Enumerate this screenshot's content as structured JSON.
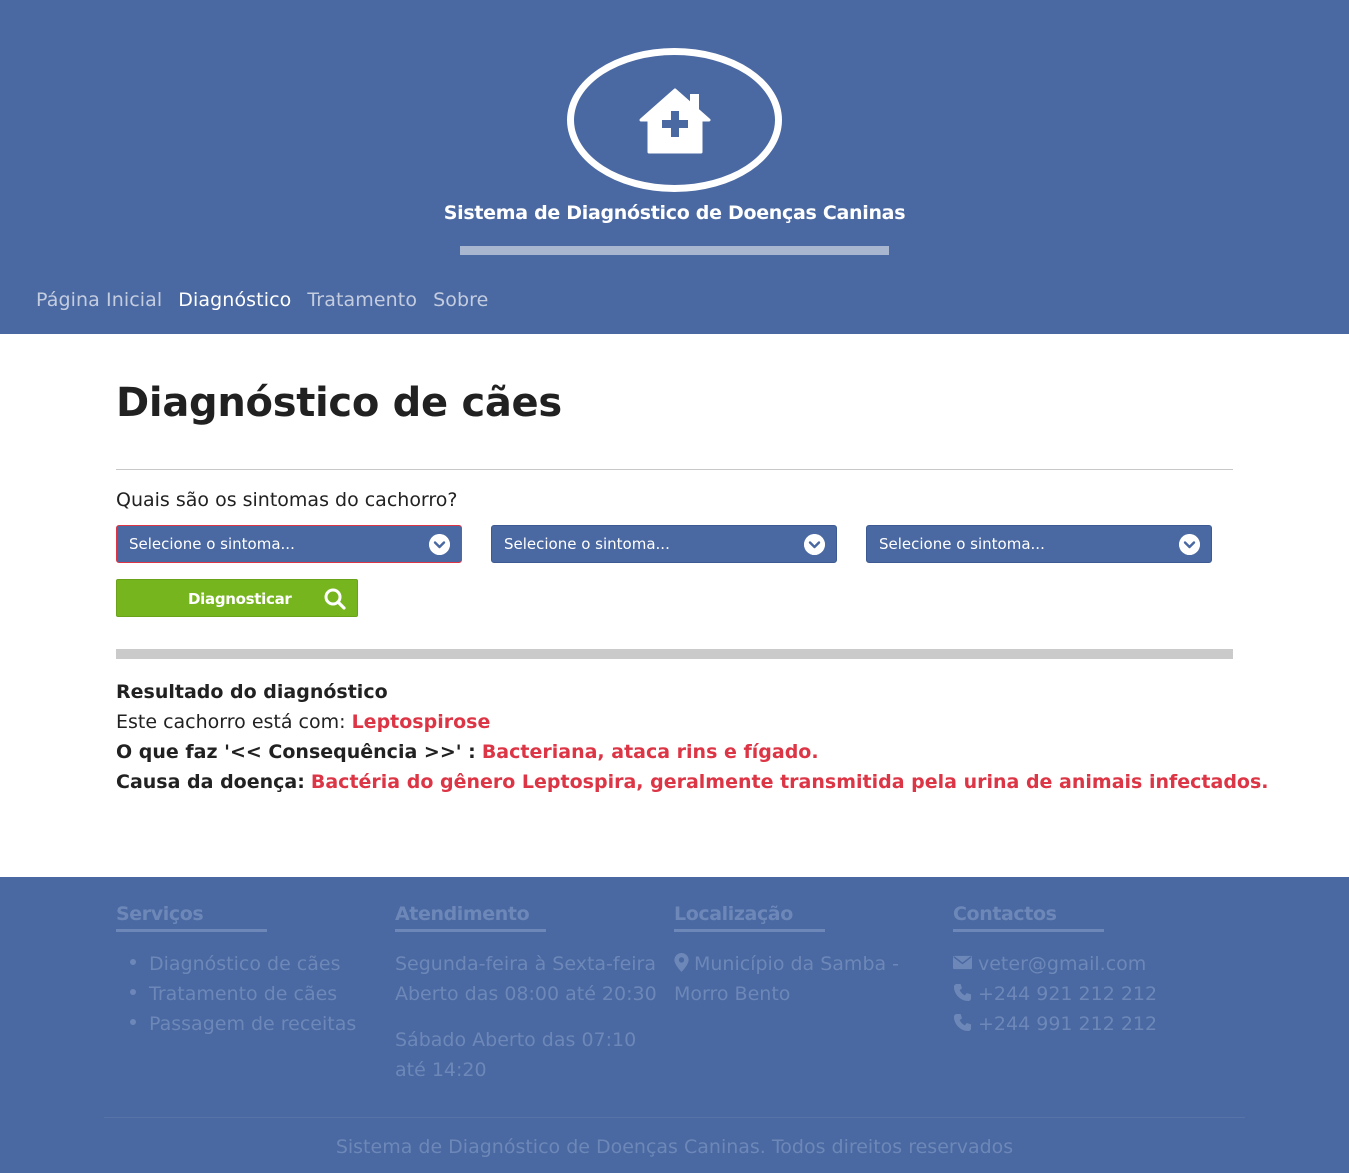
{
  "header": {
    "logo_icon": "house-medical-icon",
    "site_title": "Sistema de Diagnóstico de Doenças Caninas"
  },
  "nav": {
    "items": [
      {
        "label": "Página Inicial",
        "active": false
      },
      {
        "label": "Diagnóstico",
        "active": true
      },
      {
        "label": "Tratamento",
        "active": false
      },
      {
        "label": "Sobre",
        "active": false
      }
    ]
  },
  "main": {
    "title": "Diagnóstico de cães",
    "question": "Quais são os sintomas do cachorro?",
    "selects": [
      {
        "value": "Selecione o sintoma...",
        "invalid": true
      },
      {
        "value": "Selecione o sintoma...",
        "invalid": false
      },
      {
        "value": "Selecione o sintoma...",
        "invalid": false
      }
    ],
    "diagnose_button": "Diagnosticar",
    "diagnose_icon": "search-icon"
  },
  "result": {
    "heading": "Resultado do diagnóstico",
    "disease_label": "Este cachorro está com:",
    "disease_value": "Leptospirose",
    "consequence_label": "O que faz '<< Consequência >>' :",
    "consequence_value": "Bacteriana, ataca rins e fígado.",
    "cause_label": "Causa da doença:",
    "cause_value": "Bactéria do gênero Leptospira, geralmente transmitida pela urina de animais infectados."
  },
  "footer": {
    "services": {
      "heading": "Serviços",
      "items": [
        "Diagnóstico de cães",
        "Tratamento de cães",
        "Passagem de receitas"
      ]
    },
    "hours": {
      "heading": "Atendimento",
      "line1": "Segunda-feira à Sexta-feira",
      "line2": "Aberto das 08:00 até 20:30",
      "line3": "Sábado Aberto das 07:10",
      "line4": "até 14:20"
    },
    "location": {
      "heading": "Localização",
      "line1": "Município da Samba -",
      "line2": "Morro Bento",
      "icon": "map-marker-icon"
    },
    "contacts": {
      "heading": "Contactos",
      "email": "veter@gmail.com",
      "phone1": "+244 921 212 212",
      "phone2": "+244 991 212 212",
      "email_icon": "envelope-icon",
      "phone_icon": "phone-icon"
    },
    "copyright": "Sistema de Diagnóstico de Doenças Caninas. Todos direitos reservados"
  },
  "colors": {
    "primary": "#4a68a1",
    "success": "#77b51f",
    "danger": "#dc3545"
  }
}
